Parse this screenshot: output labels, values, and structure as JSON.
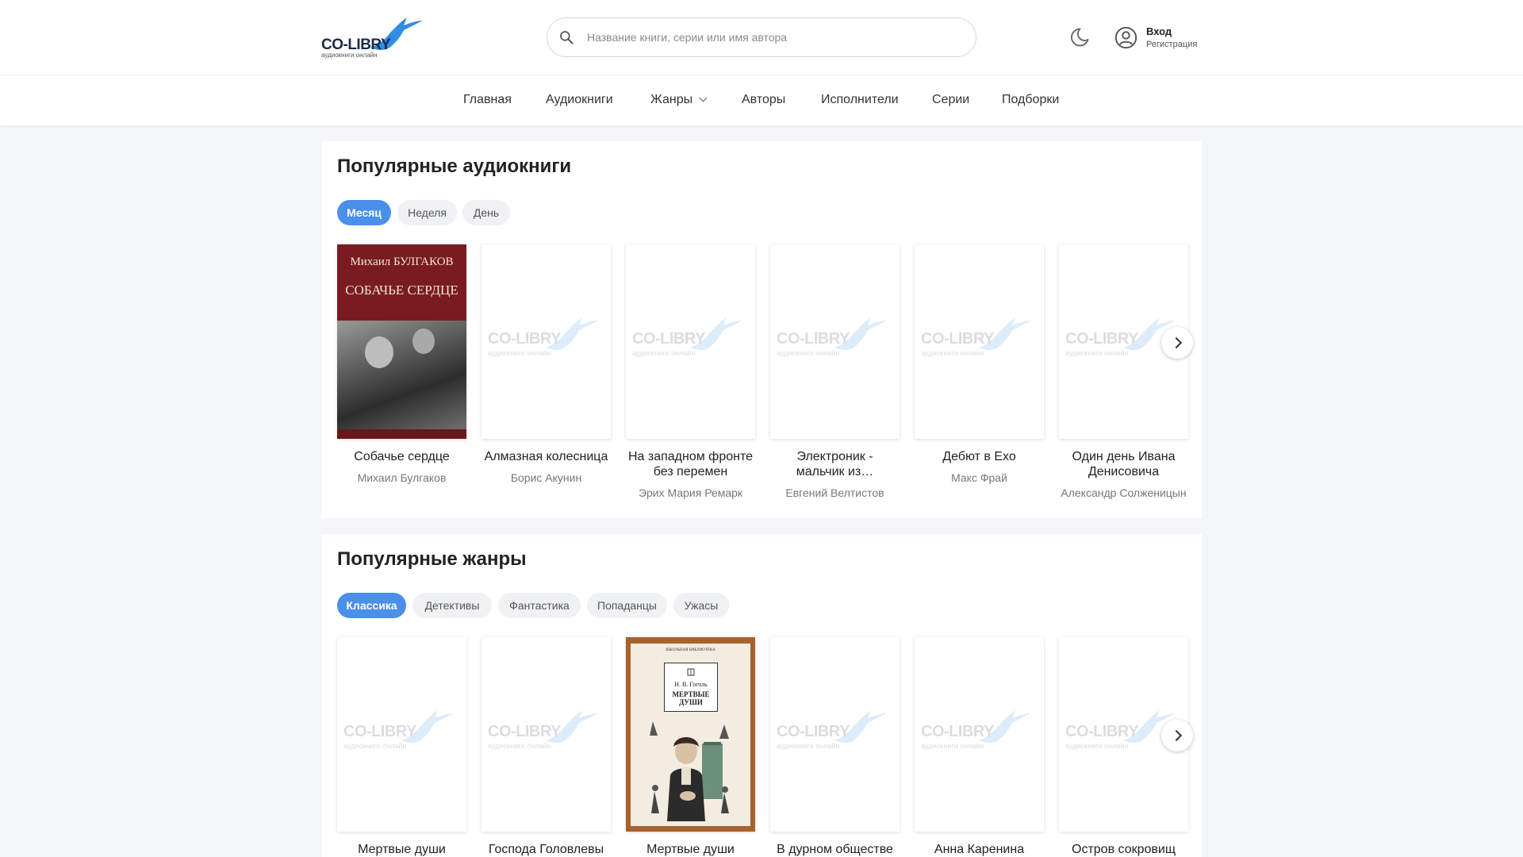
{
  "header": {
    "logo_text": "CO-LIBRY",
    "logo_subtitle": "аудиокниги онлайн",
    "search_placeholder": "Название книги, серии или имя автора",
    "login_label": "Вход",
    "register_label": "Регистрация"
  },
  "nav": {
    "items": [
      "Главная",
      "Аудиокниги",
      "Жанры",
      "Авторы",
      "Исполнители",
      "Серии",
      "Подборки"
    ]
  },
  "popular_books": {
    "title": "Популярные аудиокниги",
    "tabs": [
      {
        "label": "Месяц",
        "active": true
      },
      {
        "label": "Неделя",
        "active": false
      },
      {
        "label": "День",
        "active": false
      }
    ],
    "books": [
      {
        "title": "Собачье сердце",
        "author": "Михаил Булгаков",
        "cover": "bulgakov"
      },
      {
        "title": "Алмазная колесница",
        "author": "Борис Акунин",
        "cover": "placeholder"
      },
      {
        "title": "На западном фронте без перемен",
        "author": "Эрих Мария Ремарк",
        "cover": "placeholder"
      },
      {
        "title": "Электроник - мальчик из…",
        "author": "Евгений Велтистов",
        "cover": "placeholder"
      },
      {
        "title": "Дебют в Ехо",
        "author": "Макс Фрай",
        "cover": "placeholder"
      },
      {
        "title": "Один день Ивана Денисовича",
        "author": "Александр Солженицын",
        "cover": "placeholder"
      }
    ]
  },
  "popular_genres": {
    "title": "Популярные жанры",
    "tabs": [
      {
        "label": "Классика",
        "active": true
      },
      {
        "label": "Детективы",
        "active": false
      },
      {
        "label": "Фантастика",
        "active": false
      },
      {
        "label": "Попаданцы",
        "active": false
      },
      {
        "label": "Ужасы",
        "active": false
      }
    ],
    "books": [
      {
        "title": "Мертвые души",
        "cover": "placeholder"
      },
      {
        "title": "Господа Головлевы",
        "cover": "placeholder"
      },
      {
        "title": "Мертвые души",
        "cover": "gogol"
      },
      {
        "title": "В дурном обществе",
        "cover": "placeholder"
      },
      {
        "title": "Анна Каренина",
        "cover": "placeholder"
      },
      {
        "title": "Остров сокровищ",
        "cover": "placeholder"
      }
    ]
  },
  "covers": {
    "bulgakov": {
      "author": "Михаил БУЛГАКОВ",
      "title": "СОБАЧЬЕ СЕРДЦЕ"
    },
    "gogol": {
      "series": "ШКОЛЬНАЯ БИБЛИОТЕКА",
      "author": "Н. В. Гоголь",
      "title": "МЕРТВЫЕ ДУШИ"
    }
  },
  "colors": {
    "accent": "#4a8fea",
    "logo_bird": "#2f8de4",
    "background": "#f5f6f8"
  }
}
